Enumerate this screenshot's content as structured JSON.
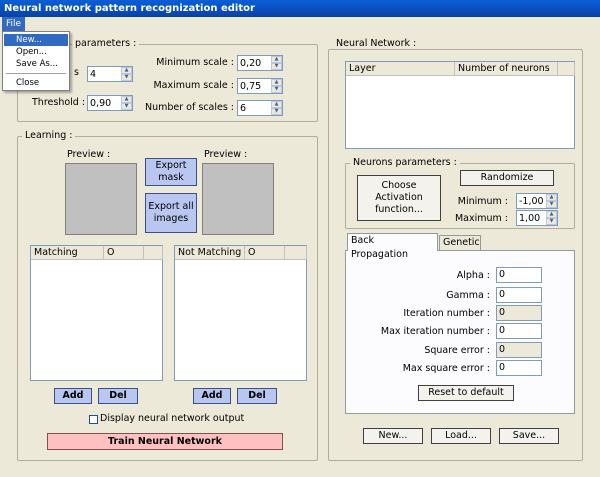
{
  "window": {
    "title": "Neural network pattern recognization editor"
  },
  "menu": {
    "file": "File",
    "items": [
      {
        "label": "New..."
      },
      {
        "label": "Open..."
      },
      {
        "label": "Save As..."
      },
      {
        "label": "Close"
      }
    ]
  },
  "scan": {
    "group_label": "parameters :",
    "field1_label": "s",
    "field1_value": "4",
    "threshold_label": "Threshold :",
    "threshold_value": "0,90",
    "min_scale_label": "Minimum scale :",
    "min_scale_value": "0,20",
    "max_scale_label": "Maximum scale :",
    "max_scale_value": "0,75",
    "num_scales_label": "Number of scales :",
    "num_scales_value": "6"
  },
  "learning": {
    "group_label": "Learning :",
    "preview_left": "Preview :",
    "preview_right": "Preview :",
    "export_mask": "Export mask",
    "export_all": "Export all images",
    "matching_cols": [
      "Matching",
      "O"
    ],
    "not_matching_cols": [
      "Not Matching",
      "O"
    ],
    "add": "Add",
    "del": "Del",
    "add2": "Add",
    "del2": "Del",
    "display_output": "Display neural network output",
    "train": "Train Neural Network"
  },
  "network": {
    "group_label": "Neural Network :",
    "cols": [
      "Layer",
      "Number of neurons"
    ],
    "neurons_group": "Neurons parameters :",
    "choose_activation": "Choose Activation function...",
    "randomize": "Randomize",
    "minimum_label": "Minimum :",
    "minimum_value": "-1,00",
    "maximum_label": "Maximum :",
    "maximum_value": "1,00",
    "tabs": [
      "Back Propagation",
      "Genetic"
    ],
    "bp": {
      "alpha_label": "Alpha :",
      "alpha_value": "0",
      "gamma_label": "Gamma :",
      "gamma_value": "0",
      "iter_label": "Iteration number :",
      "iter_value": "0",
      "max_iter_label": "Max iteration number :",
      "max_iter_value": "0",
      "sq_err_label": "Square error :",
      "sq_err_value": "0",
      "max_sq_err_label": "Max square error :",
      "max_sq_err_value": "0",
      "reset": "Reset to default"
    },
    "new": "New...",
    "load": "Load...",
    "save": "Save..."
  }
}
